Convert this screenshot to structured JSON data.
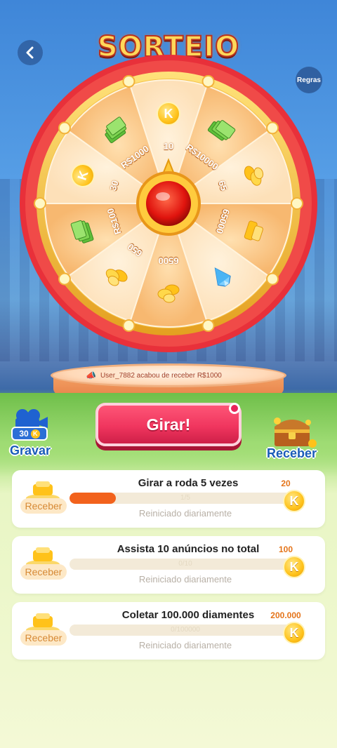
{
  "header": {
    "title": "SORTEIO",
    "rules_label": "Regras"
  },
  "wheel": {
    "segments": [
      {
        "label": "10",
        "icon": "k-coin-icon"
      },
      {
        "label": "R$10000",
        "icon": "cash-stack-icon"
      },
      {
        "label": "65",
        "icon": "gold-coins-icon"
      },
      {
        "label": "65000",
        "icon": "gold-bars-icon"
      },
      {
        "label": "",
        "icon": "diamond-icon"
      },
      {
        "label": "6500",
        "icon": "gold-coins-icon"
      },
      {
        "label": "650",
        "icon": "gold-coins-icon"
      },
      {
        "label": "R$100",
        "icon": "cash-stack-icon"
      },
      {
        "label": "30",
        "icon": "k-coin-icon"
      },
      {
        "label": "R$1000",
        "icon": "cash-stack-icon"
      }
    ]
  },
  "ticker": {
    "message": "User_7882 acabou de receber R$1000"
  },
  "actions": {
    "spin_label": "Girar!",
    "record_label": "Gravar",
    "record_cost": "30",
    "receive_label": "Receber"
  },
  "tasks": [
    {
      "title": "Girar a roda  5  vezes",
      "progress": "1/5",
      "progress_fraction": 0.2,
      "reset": "Reiniciado diariamente",
      "reward": "20",
      "claim_label": "Receber"
    },
    {
      "title": "Assista 10 anúncios no total",
      "progress": "0/10",
      "progress_fraction": 0,
      "reset": "Reiniciado diariamente",
      "reward": "100",
      "claim_label": "Receber"
    },
    {
      "title": "Coletar 100.000 diamentes",
      "progress": "0/100000",
      "progress_fraction": 0,
      "reset": "Reiniciado diariamente",
      "reward": "200.000",
      "claim_label": "Receber"
    }
  ],
  "colors": {
    "accent_red": "#f0355e",
    "accent_orange": "#f2621c",
    "coin_gold": "#ffc21a",
    "brand_blue": "#1a5cb8"
  }
}
